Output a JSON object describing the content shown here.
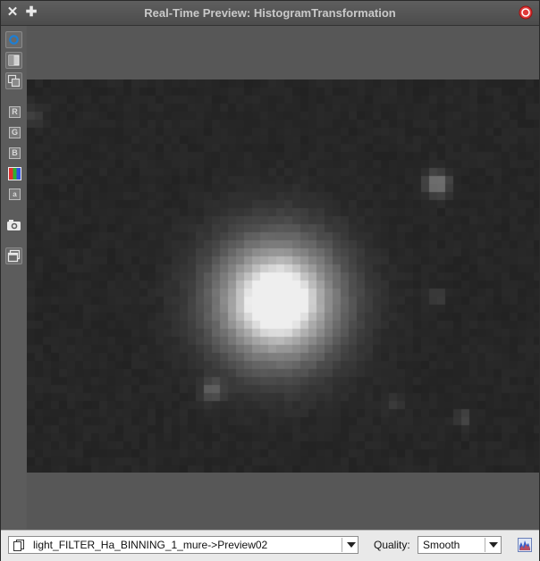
{
  "window": {
    "title": "Real-Time Preview: HistogramTransformation",
    "close_glyph": "✕",
    "pin_glyph": "✚"
  },
  "toolbar": {
    "tools": [
      "zoom-tool-icon",
      "mask-tool-icon",
      "duplicate-tool-icon"
    ],
    "channels": [
      {
        "label": "R",
        "name": "channel-red-button"
      },
      {
        "label": "G",
        "name": "channel-green-button"
      },
      {
        "label": "B",
        "name": "channel-blue-button"
      },
      {
        "label": "",
        "name": "channel-rgb-button"
      },
      {
        "label": "a",
        "name": "channel-alpha-button"
      }
    ]
  },
  "footer": {
    "view_selector": "light_FILTER_Ha_BINNING_1_mure->Preview02",
    "quality_label": "Quality:",
    "quality_value": "Smooth"
  },
  "colors": {
    "accent": "#1b7fd6",
    "close_red": "#d92626",
    "image_bg": "#242424"
  }
}
